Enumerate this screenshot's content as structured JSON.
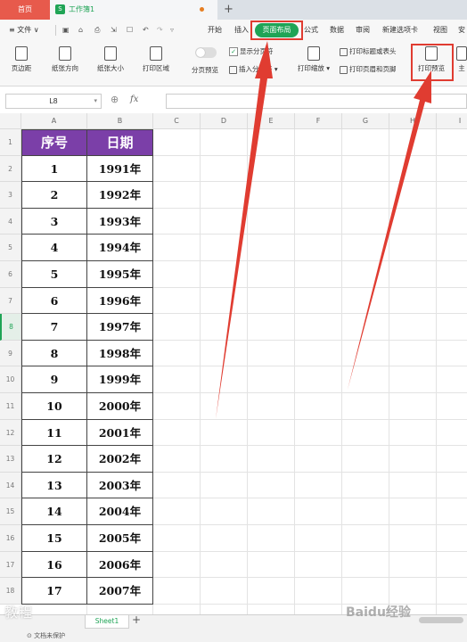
{
  "tabs": {
    "home": "首页",
    "doc_badge": "S",
    "doc": "工作簿1",
    "new_tab": "+"
  },
  "menu": {
    "items": [
      "≡ 文件 ∨"
    ],
    "ribbon_tabs": [
      "开始",
      "插入",
      "页面布局",
      "公式",
      "数据",
      "审阅",
      "新建选项卡",
      "视图",
      "安"
    ],
    "active_tab": "页面布局"
  },
  "ribbon": {
    "buttons": [
      "页边距",
      "纸张方向",
      "纸张大小",
      "打印区域",
      "分页预览",
      "打印缩放",
      "打印预览",
      "主"
    ],
    "show_page_break": "显示分页符",
    "insert_page_break": "插入分页符",
    "print_title": "打印标题或表头",
    "print_header_footer": "打印页眉和页脚"
  },
  "formula_bar": {
    "cell_ref": "L8",
    "fx": "fx",
    "value": ""
  },
  "columns": [
    "A",
    "B",
    "C",
    "D",
    "E",
    "F",
    "G",
    "H",
    "I"
  ],
  "rows": [
    "1",
    "2",
    "3",
    "4",
    "5",
    "6",
    "7",
    "8",
    "9",
    "10",
    "11",
    "12",
    "13",
    "14",
    "15",
    "16",
    "17",
    "18"
  ],
  "selected_row": "8",
  "table": {
    "headers": [
      "序号",
      "日期"
    ],
    "rows": [
      [
        "1",
        "1991年"
      ],
      [
        "2",
        "1992年"
      ],
      [
        "3",
        "1993年"
      ],
      [
        "4",
        "1994年"
      ],
      [
        "5",
        "1995年"
      ],
      [
        "6",
        "1996年"
      ],
      [
        "7",
        "1997年"
      ],
      [
        "8",
        "1998年"
      ],
      [
        "9",
        "1999年"
      ],
      [
        "10",
        "2000年"
      ],
      [
        "11",
        "2001年"
      ],
      [
        "12",
        "2002年"
      ],
      [
        "13",
        "2003年"
      ],
      [
        "14",
        "2004年"
      ],
      [
        "15",
        "2005年"
      ],
      [
        "16",
        "2006年"
      ],
      [
        "17",
        "2007年"
      ]
    ]
  },
  "sheet_tab": "Sheet1",
  "add_sheet": "+",
  "status": "文档未保护",
  "watermarks": {
    "left": "教程",
    "right": "Baidu经验"
  },
  "colors": {
    "accent": "#1fa456",
    "header_fill": "#7b3fa8",
    "annotation": "#e03c31",
    "home_tab": "#e75a4c"
  }
}
